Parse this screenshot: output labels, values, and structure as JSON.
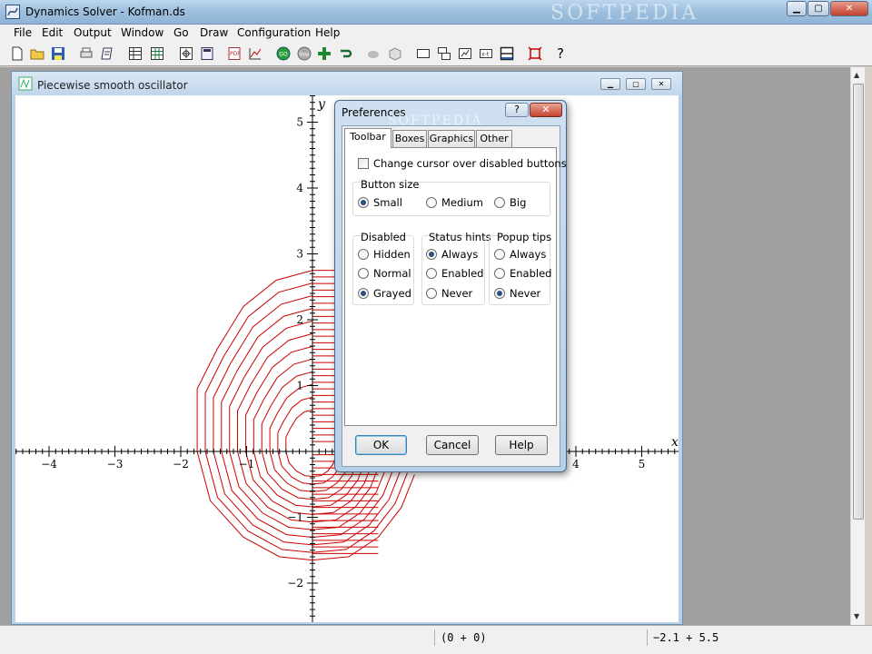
{
  "window": {
    "title": "Dynamics Solver - Kofman.ds",
    "watermark": "SOFTPEDIA",
    "minimize": "▁",
    "maximize": "▢",
    "close": "✕"
  },
  "menu": [
    "File",
    "Edit",
    "Output",
    "Window",
    "Go",
    "Draw",
    "Configuration",
    "Help"
  ],
  "toolbar": {
    "help_glyph": "?",
    "icons": [
      "new-file-icon",
      "open-folder-icon",
      "save-icon",
      "print-icon",
      "print-preview-icon",
      "table-icon",
      "table-grid-icon",
      "zoom-icon",
      "calculator-icon",
      "pdf-icon",
      "plot-icon",
      "go-icon",
      "stop-icon",
      "add-icon",
      "return-icon",
      "cloud-icon",
      "3d-box-icon",
      "window-icon",
      "cascade-icon",
      "tile-icon",
      "compare-icon",
      "layout-icon",
      "fit-window-icon",
      "help-icon"
    ]
  },
  "child": {
    "title": "Piecewise smooth oscillator"
  },
  "chart_data": {
    "type": "line",
    "title": "",
    "xlabel": "x",
    "ylabel": "y",
    "xlim": [
      -4.5,
      5.5
    ],
    "ylim": [
      -2.6,
      5.5
    ],
    "xticks": [
      -4,
      -3,
      -2,
      -1,
      4,
      5
    ],
    "yticks": [
      5,
      4,
      3,
      2,
      1,
      -1,
      -2
    ],
    "grid": false,
    "series_color": "#cc0000",
    "series": [
      {
        "values": "family of nested piecewise-smooth closed orbits around the origin"
      }
    ]
  },
  "status": {
    "coords": "(0 + 0)",
    "range": "−2.1 + 5.5"
  },
  "dialog": {
    "title": "Preferences",
    "watermark": "SOFTPEDIA",
    "help_glyph": "?",
    "close_glyph": "✕",
    "tabs": [
      "Toolbar",
      "Boxes",
      "Graphics",
      "Other"
    ],
    "active_tab": "Toolbar",
    "change_cursor_label": "Change cursor over disabled buttons",
    "change_cursor_checked": false,
    "button_size": {
      "title": "Button size",
      "options": [
        "Small",
        "Medium",
        "Big"
      ],
      "selected": "Small"
    },
    "disabled": {
      "title": "Disabled",
      "options": [
        "Hidden",
        "Normal",
        "Grayed"
      ],
      "selected": "Grayed"
    },
    "status_hints": {
      "title": "Status hints",
      "options": [
        "Always",
        "Enabled",
        "Never"
      ],
      "selected": "Always"
    },
    "popup_tips": {
      "title": "Popup tips",
      "options": [
        "Always",
        "Enabled",
        "Never"
      ],
      "selected": "Never"
    },
    "ok": "OK",
    "cancel": "Cancel",
    "help": "Help"
  },
  "colors": {
    "orbit": "#cc0000",
    "accent": "#2b4f81"
  }
}
